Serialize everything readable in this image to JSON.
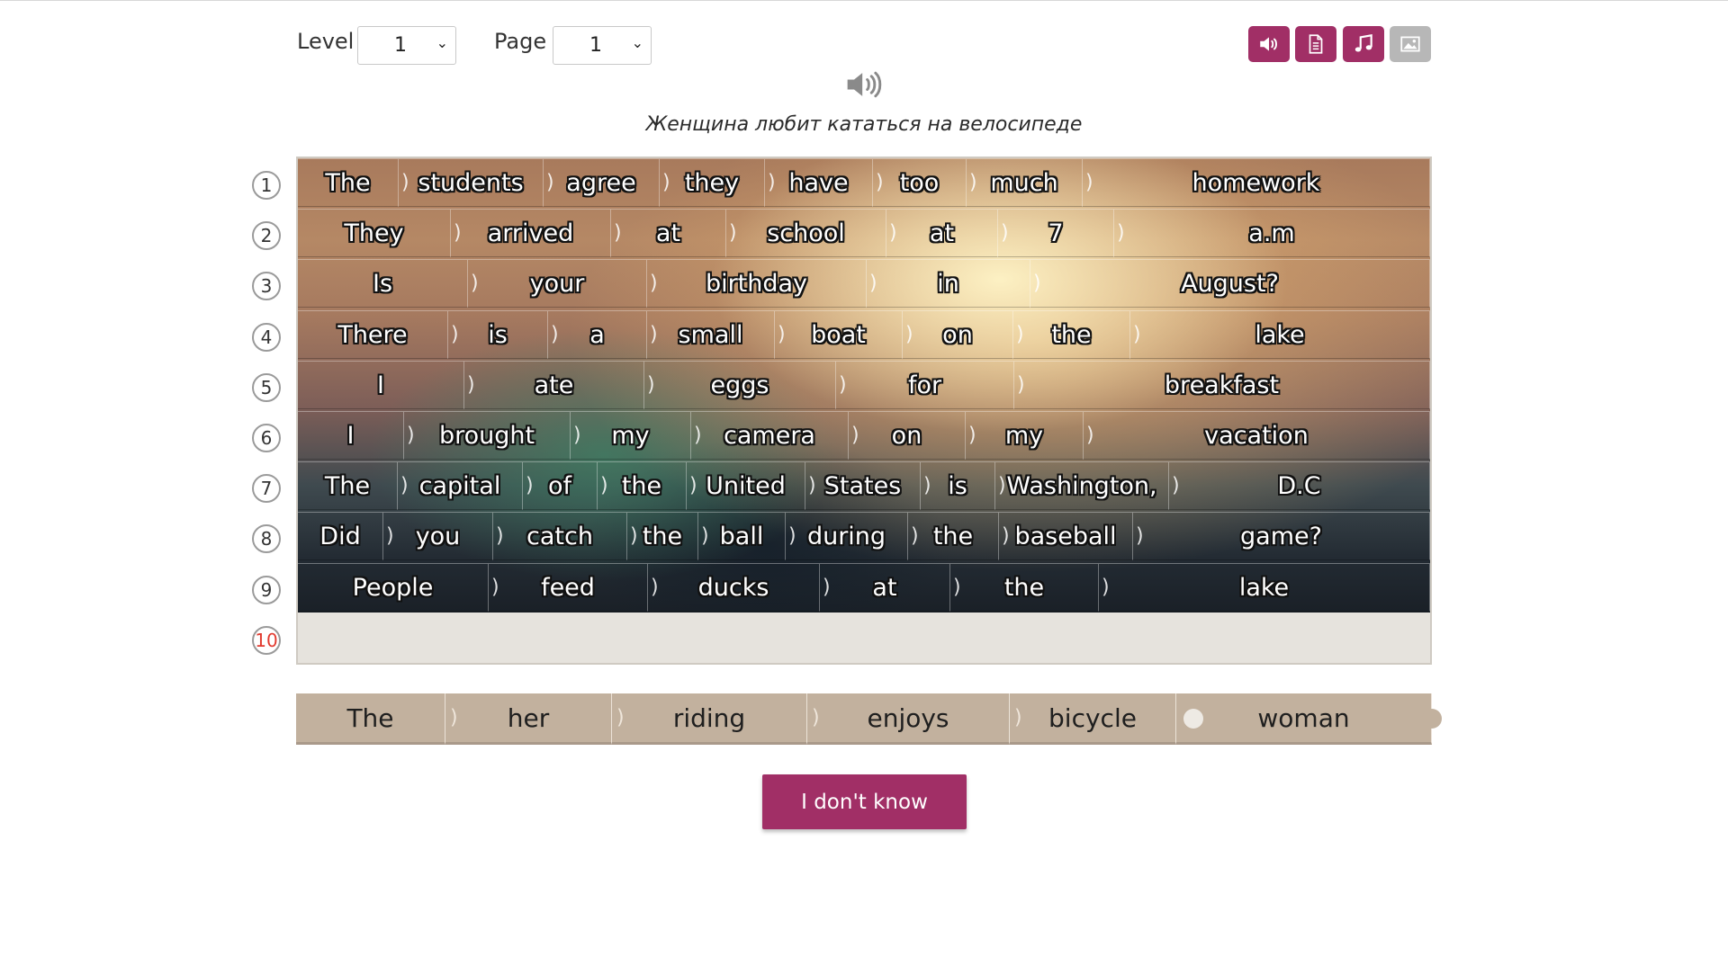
{
  "controls": {
    "level_label": "Level",
    "level_value": "1",
    "page_label": "Page",
    "page_value": "1"
  },
  "toolbar": {
    "buttons": [
      {
        "icon": "speaker-icon",
        "enabled": true
      },
      {
        "icon": "document-icon",
        "enabled": true
      },
      {
        "icon": "music-note-icon",
        "enabled": true
      },
      {
        "icon": "image-icon",
        "enabled": false
      }
    ]
  },
  "translation": "Женщина любит кататься на велосипеде",
  "rows": [
    {
      "number": "1",
      "words": [
        "The",
        "students",
        "agree",
        "they",
        "have",
        "too",
        "much",
        "homework"
      ]
    },
    {
      "number": "2",
      "words": [
        "They",
        "arrived",
        "at",
        "school",
        "at",
        "7",
        "a.m"
      ]
    },
    {
      "number": "3",
      "words": [
        "Is",
        "your",
        "birthday",
        "in",
        "August?"
      ]
    },
    {
      "number": "4",
      "words": [
        "There",
        "is",
        "a",
        "small",
        "boat",
        "on",
        "the",
        "lake"
      ]
    },
    {
      "number": "5",
      "words": [
        "I",
        "ate",
        "eggs",
        "for",
        "breakfast"
      ]
    },
    {
      "number": "6",
      "words": [
        "I",
        "brought",
        "my",
        "camera",
        "on",
        "my",
        "vacation"
      ]
    },
    {
      "number": "7",
      "words": [
        "The",
        "capital",
        "of",
        "the",
        "United",
        "States",
        "is",
        "Washington,",
        "D.C"
      ]
    },
    {
      "number": "8",
      "words": [
        "Did",
        "you",
        "catch",
        "the",
        "ball",
        "during",
        "the",
        "baseball",
        "game?"
      ]
    },
    {
      "number": "9",
      "words": [
        "People",
        "feed",
        "ducks",
        "at",
        "the",
        "lake"
      ]
    },
    {
      "number": "10",
      "words": []
    }
  ],
  "word_bank": [
    "The",
    "her",
    "riding",
    "enjoys",
    "bicycle",
    "woman"
  ],
  "dont_know_label": "I don't know",
  "colors": {
    "accent": "#a12f66",
    "disabled": "#b7b7b7",
    "bank_tile": "#c2b19e",
    "active_row_number": "#e23a2f"
  }
}
